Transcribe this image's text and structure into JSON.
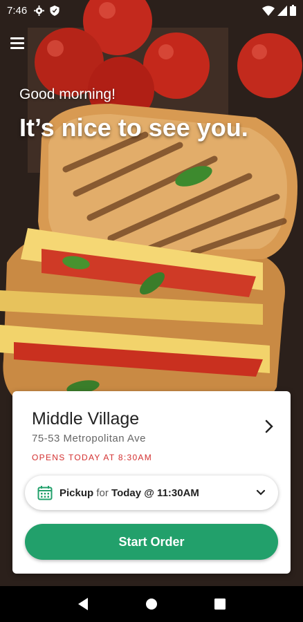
{
  "status_bar": {
    "time": "7:46",
    "left_icons": [
      "gear-icon",
      "shield-icon"
    ],
    "right_icons": [
      "wifi-icon",
      "signal-icon",
      "battery-icon"
    ]
  },
  "hero": {
    "greeting": "Good morning!",
    "headline": "It’s nice to see you."
  },
  "location_card": {
    "name": "Middle Village",
    "address": "75-53 Metropolitan Ave",
    "hours_status": "OPENS TODAY AT 8:30AM",
    "pickup": {
      "mode": "Pickup",
      "connector": " for ",
      "when": "Today @ 11:30AM"
    },
    "cta_label": "Start Order"
  },
  "colors": {
    "accent_green": "#22a06b",
    "hours_red": "#d32f2f"
  },
  "nav_bar": [
    "back-icon",
    "home-icon",
    "recents-icon"
  ]
}
